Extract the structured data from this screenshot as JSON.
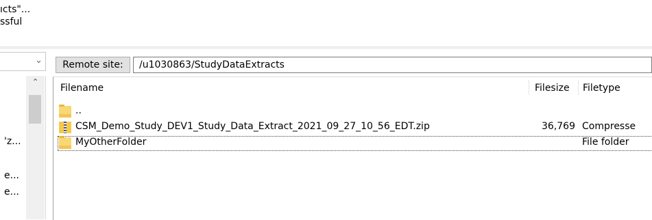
{
  "message_log": {
    "lines": [
      "ıcts\"...",
      "ssful"
    ]
  },
  "local": {
    "tree_items": [
      "'z...",
      "e...",
      "e..."
    ]
  },
  "remote": {
    "site_label": "Remote site:",
    "path": "/u1030863/StudyDataExtracts",
    "columns": {
      "filename": "Filename",
      "filesize": "Filesize",
      "filetype": "Filetype"
    },
    "files": [
      {
        "name": "..",
        "size": "",
        "type": "",
        "icon": "folder-icon"
      },
      {
        "name": "CSM_Demo_Study_DEV1_Study_Data_Extract_2021_09_27_10_56_EDT.zip",
        "size": "36,769",
        "type": "Compresse",
        "icon": "zip-file-icon"
      },
      {
        "name": "MyOtherFolder",
        "size": "",
        "type": "File folder",
        "icon": "folder-icon"
      }
    ]
  }
}
